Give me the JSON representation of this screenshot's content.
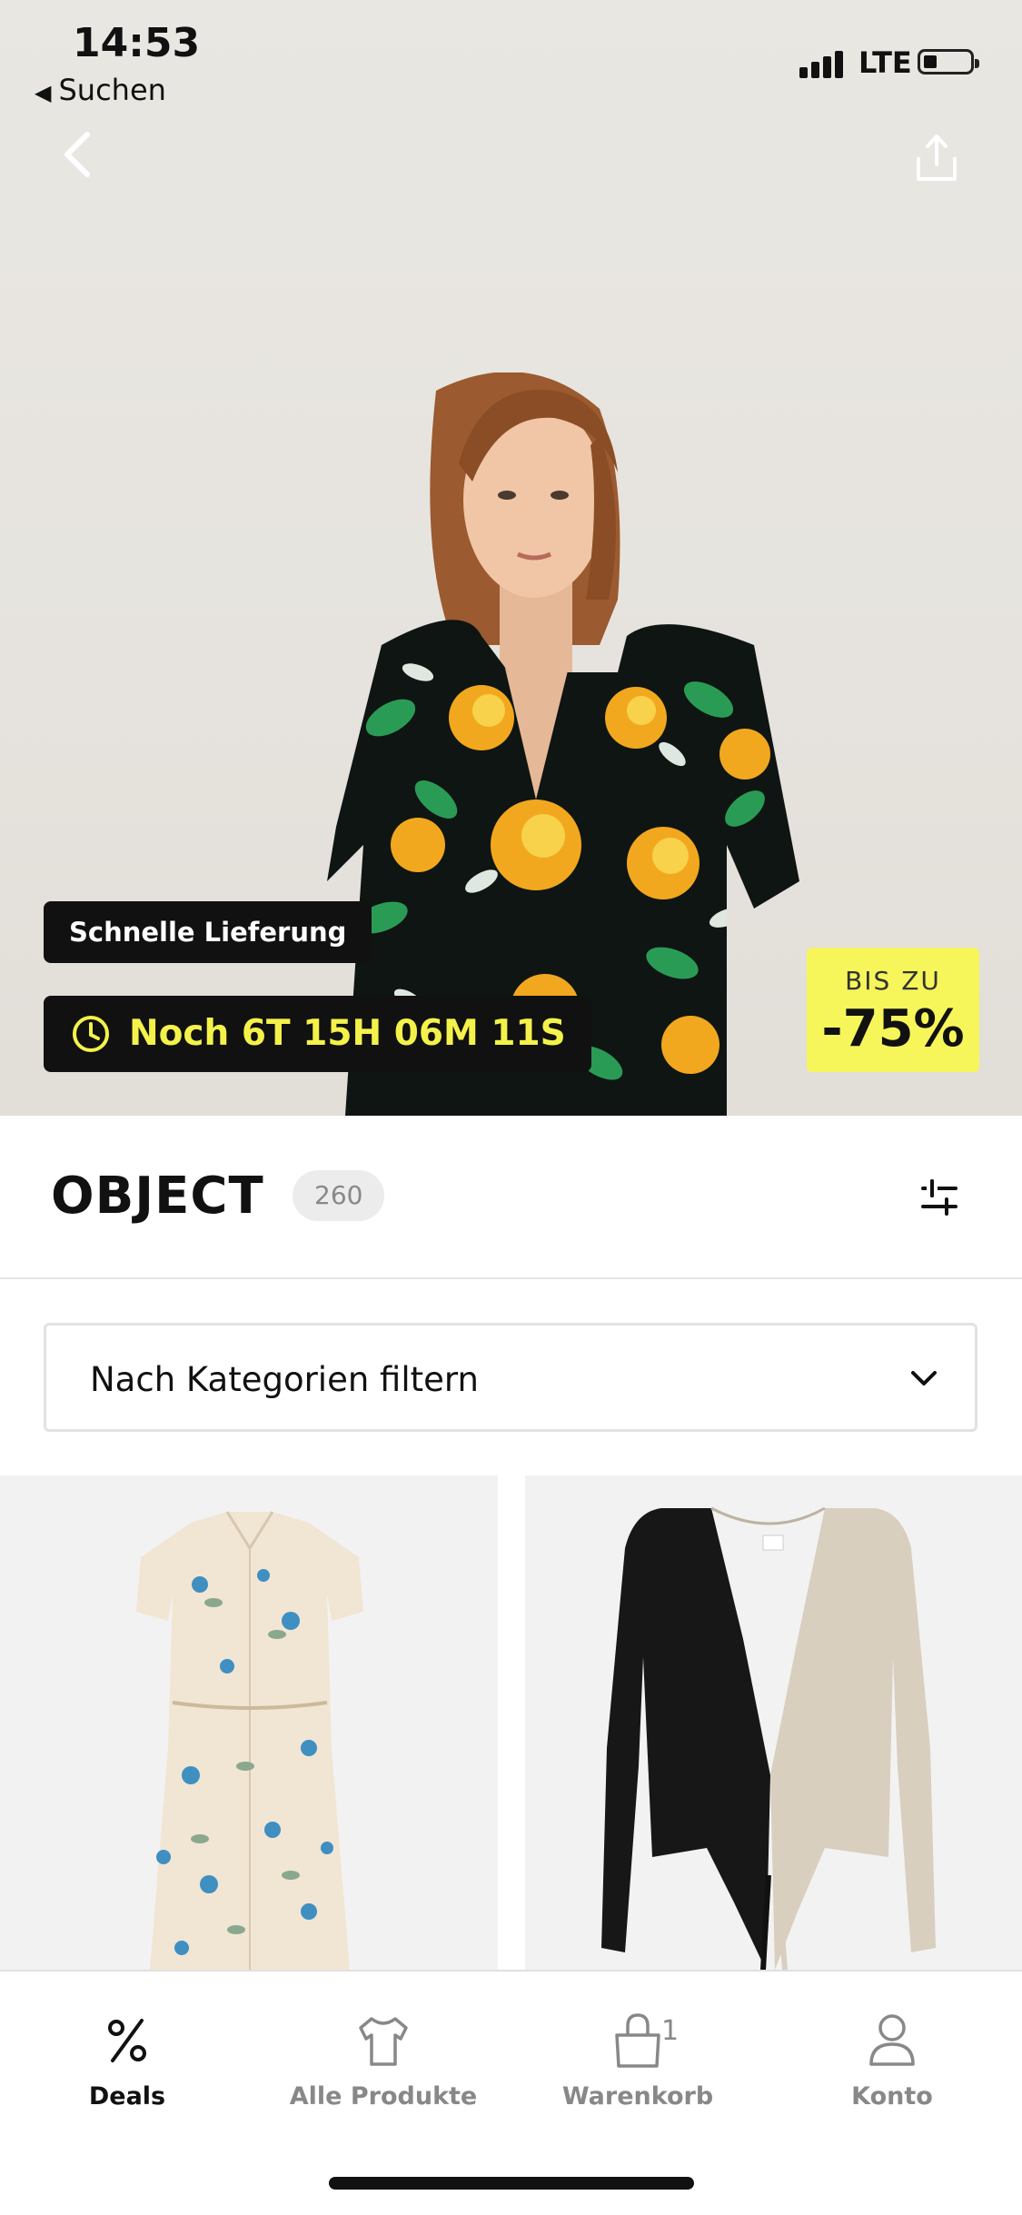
{
  "status_bar": {
    "time": "14:53",
    "back_app": "Suchen",
    "network": "LTE"
  },
  "hero": {
    "fast_delivery": "Schnelle Lieferung",
    "timer": "Noch 6T 15H 06M 11S",
    "deal_small": "BIS ZU",
    "deal_big": "-75%",
    "icons": {
      "back": "chevron-left-icon",
      "share": "share-icon",
      "timer": "clock-icon"
    }
  },
  "brand": {
    "name": "OBJECT",
    "count": "260",
    "filter_icon": "sliders-icon"
  },
  "category_filter": {
    "label": "Nach Kategorien filtern",
    "icon": "chevron-down-icon"
  },
  "products": [
    {
      "name": "floral-shirt-dress"
    },
    {
      "name": "two-tone-wrap-cardigan"
    }
  ],
  "tabbar": {
    "items": [
      {
        "label": "Deals",
        "icon": "percent-icon",
        "active": true
      },
      {
        "label": "Alle Produkte",
        "icon": "shirt-icon",
        "active": false
      },
      {
        "label": "Warenkorb",
        "icon": "bag-icon",
        "count": "1",
        "active": false
      },
      {
        "label": "Konto",
        "icon": "person-icon",
        "active": false
      }
    ]
  },
  "colors": {
    "accent_yellow": "#f6f65a",
    "timer_text": "#f4f24a",
    "dark": "#111111"
  }
}
